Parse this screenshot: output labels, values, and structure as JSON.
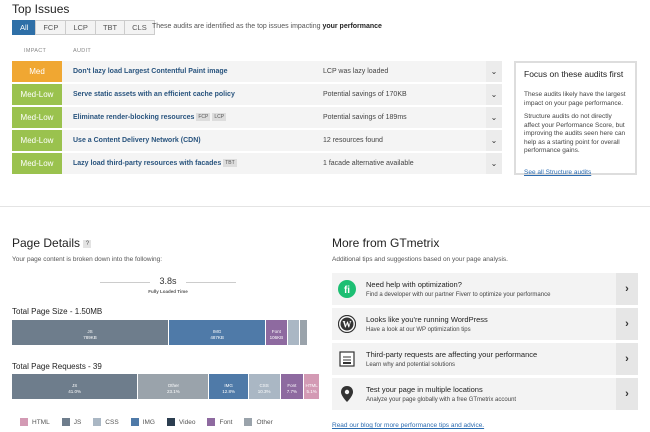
{
  "top_issues": {
    "title": "Top Issues",
    "filters": [
      "All",
      "FCP",
      "LCP",
      "TBT",
      "CLS"
    ],
    "filter_desc_prefix": "These audits are identified as the top issues impacting ",
    "filter_desc_bold": "your performance",
    "col_impact": "IMPACT",
    "col_audit": "AUDIT",
    "rows": [
      {
        "impact": "Med",
        "audit": "Don't lazy load Largest Contentful Paint image",
        "tags": [],
        "result": "LCP was lazy loaded",
        "color": "#f0a732"
      },
      {
        "impact": "Med-Low",
        "audit": "Serve static assets with an efficient cache policy",
        "tags": [],
        "result": "Potential savings of 170KB",
        "color": "#9ac24e"
      },
      {
        "impact": "Med-Low",
        "audit": "Eliminate render-blocking resources",
        "tags": [
          "FCP",
          "LCP"
        ],
        "result": "Potential savings of 189ms",
        "color": "#9ac24e"
      },
      {
        "impact": "Med-Low",
        "audit": "Use a Content Delivery Network (CDN)",
        "tags": [],
        "result": "12 resources found",
        "color": "#9ac24e"
      },
      {
        "impact": "Med-Low",
        "audit": "Lazy load third-party resources with facades",
        "tags": [
          "TBT"
        ],
        "result": "1 facade alternative available",
        "color": "#9ac24e"
      }
    ],
    "chevron": "⌄"
  },
  "focus": {
    "title": "Focus on these audits first",
    "p1": "These audits likely have the largest impact on your page performance.",
    "p2": "Structure audits do not directly affect your Performance Score, but improving the audits seen here can help as a starting point for overall performance gains.",
    "link": "See all Structure audits"
  },
  "page_details": {
    "title": "Page Details",
    "help": "?",
    "desc": "Your page content is broken down into the following:",
    "fully_loaded_value": "3.8s",
    "fully_loaded_label": "Fully Loaded Time",
    "size_title": "Total Page Size - 1.50MB",
    "size_segments": [
      {
        "label": "JS",
        "value": "789KB",
        "share": 0.51,
        "color": "#6e7d8c"
      },
      {
        "label": "IMG",
        "value": "487KB",
        "share": 0.315,
        "color": "#4f7aa8"
      },
      {
        "label": "Font",
        "value": "106KB",
        "share": 0.07,
        "color": "#8e6aa0"
      },
      {
        "label": "",
        "value": "",
        "share": 0.04,
        "color": "#aab7c4"
      },
      {
        "label": "",
        "value": "",
        "share": 0.025,
        "color": "#9aa3ab"
      },
      {
        "label": "",
        "value": "",
        "share": 0.04,
        "color": "#ffffff"
      }
    ],
    "requests_title": "Total Page Requests - 39",
    "request_segments": [
      {
        "label": "JS",
        "value": "41.0%",
        "share": 0.41,
        "color": "#6e7d8c"
      },
      {
        "label": "Other",
        "value": "23.1%",
        "share": 0.231,
        "color": "#9aa3ab"
      },
      {
        "label": "IMG",
        "value": "12.8%",
        "share": 0.128,
        "color": "#4f7aa8"
      },
      {
        "label": "CSS",
        "value": "10.3%",
        "share": 0.103,
        "color": "#aab7c4"
      },
      {
        "label": "Font",
        "value": "7.7%",
        "share": 0.077,
        "color": "#8e6aa0"
      },
      {
        "label": "HTML",
        "value": "5.1%",
        "share": 0.051,
        "color": "#d39ab4"
      }
    ],
    "legend": [
      {
        "label": "HTML",
        "color": "#d39ab4"
      },
      {
        "label": "JS",
        "color": "#6e7d8c"
      },
      {
        "label": "CSS",
        "color": "#aab7c4"
      },
      {
        "label": "IMG",
        "color": "#4f7aa8"
      },
      {
        "label": "Video",
        "color": "#2c3e50"
      },
      {
        "label": "Font",
        "color": "#8e6aa0"
      },
      {
        "label": "Other",
        "color": "#9aa3ab"
      }
    ]
  },
  "more": {
    "title": "More from GTmetrix",
    "desc": "Additional tips and suggestions based on your page analysis.",
    "items": [
      {
        "title": "Need help with optimization?",
        "desc": "Find a developer with our partner Fiverr to optimize your performance",
        "icon": "fiverr-icon"
      },
      {
        "title": "Looks like you're running WordPress",
        "desc": "Have a look at our WP optimization tips",
        "icon": "wordpress-icon"
      },
      {
        "title": "Third-party requests are affecting your performance",
        "desc": "Learn why and potential solutions",
        "icon": "document-icon"
      },
      {
        "title": "Test your page in multiple locations",
        "desc": "Analyze your page globally with a free GTmetrix account",
        "icon": "location-pin-icon"
      }
    ],
    "chevron": "›",
    "blog_link": "Read our blog for more performance tips and advice."
  }
}
